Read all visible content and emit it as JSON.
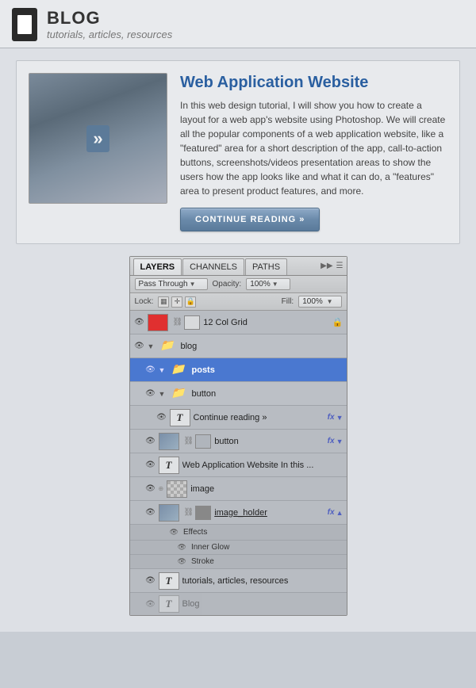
{
  "header": {
    "title": "BLOG",
    "subtitle": "tutorials, articles, resources",
    "icon_label": "blog-icon"
  },
  "article": {
    "title": "Web Application Website",
    "text": "In this web design tutorial, I will show you how to create a layout for a web app's website using Photoshop. We will create all the popular components of a web application website, like a \"featured\" area for a short description of the app, call-to-action buttons, screenshots/videos presentation areas to show the users how the app looks like and what it can do, a \"features\" area to present product features, and more.",
    "continue_btn": "CONTINUE READING »"
  },
  "layers_panel": {
    "tabs": [
      "LAYERS",
      "CHANNELS",
      "PATHS"
    ],
    "active_tab": "LAYERS",
    "blend_mode": "Pass Through",
    "opacity_label": "Opacity:",
    "opacity_value": "100%",
    "lock_label": "Lock:",
    "fill_label": "Fill:",
    "fill_value": "100%",
    "layers": [
      {
        "id": 1,
        "name": "12 Col Grid",
        "indent": 0,
        "type": "red-thumb",
        "has_lock": true,
        "has_fx": false,
        "visible": true
      },
      {
        "id": 2,
        "name": "blog",
        "indent": 0,
        "type": "folder",
        "visible": true,
        "expanded": true
      },
      {
        "id": 3,
        "name": "posts",
        "indent": 1,
        "type": "folder",
        "visible": true,
        "expanded": true,
        "selected": true
      },
      {
        "id": 4,
        "name": "button",
        "indent": 2,
        "type": "folder",
        "visible": true,
        "expanded": true
      },
      {
        "id": 5,
        "name": "Continue reading »",
        "indent": 3,
        "type": "text",
        "has_fx": true,
        "visible": true
      },
      {
        "id": 6,
        "name": "button",
        "indent": 2,
        "type": "thumb-gray",
        "has_fx": true,
        "visible": true
      },
      {
        "id": 7,
        "name": "Web Application Website In this ...",
        "indent": 2,
        "type": "text",
        "visible": true
      },
      {
        "id": 8,
        "name": "image",
        "indent": 2,
        "type": "checker",
        "visible": true
      },
      {
        "id": 9,
        "name": "image_holder",
        "indent": 2,
        "type": "thumb-img",
        "has_fx": true,
        "has_up_arrow": true,
        "visible": true
      },
      {
        "id": 10,
        "name": "Effects",
        "indent": 2,
        "type": "effects-header",
        "visible": true
      },
      {
        "id": 11,
        "name": "Inner Glow",
        "indent": 3,
        "type": "effect",
        "visible": true
      },
      {
        "id": 12,
        "name": "Stroke",
        "indent": 3,
        "type": "effect",
        "visible": true
      },
      {
        "id": 13,
        "name": "tutorials, articles, resources",
        "indent": 1,
        "type": "text",
        "visible": true
      },
      {
        "id": 14,
        "name": "Blog",
        "indent": 1,
        "type": "text-ghost",
        "visible": false
      }
    ]
  }
}
